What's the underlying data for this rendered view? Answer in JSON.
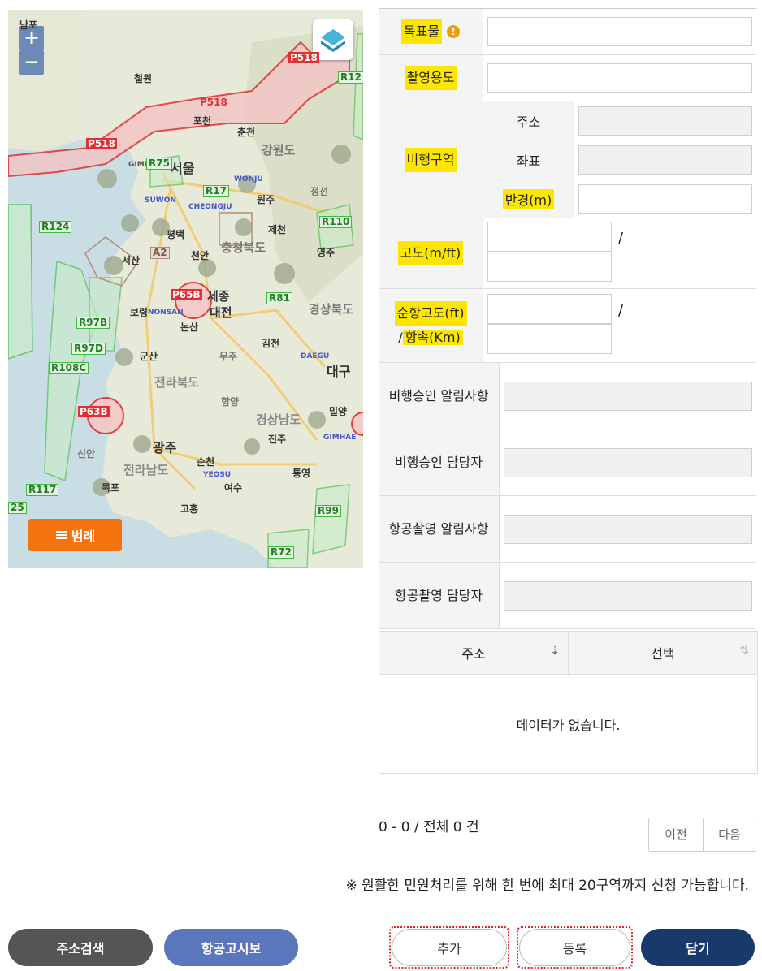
{
  "map": {
    "zoom_in": "+",
    "zoom_out": "—",
    "legend_label": "범례",
    "legend_icon": "menu-icon",
    "layer_icon": "layers-icon",
    "place_labels": [
      "남포",
      "철원",
      "포천",
      "춘천",
      "강원도",
      "서울",
      "원주",
      "평택",
      "제천",
      "영주",
      "충청북도",
      "서산",
      "천안",
      "세종",
      "보령",
      "대전",
      "논산",
      "김천",
      "경상북도",
      "대구",
      "군산",
      "무주",
      "전라북도",
      "함양",
      "밀양",
      "경상남도",
      "진주",
      "광주",
      "순천",
      "여수",
      "전라남도",
      "목포",
      "고흥",
      "통영",
      "신안",
      "정선",
      "GIMPO",
      "WONJU",
      "SUWON",
      "CHEONGJU",
      "NONSAN",
      "DAEGU",
      "GIMHAE",
      "YEOSU"
    ],
    "restricted_zones": [
      "P518",
      "P518",
      "P518",
      "P65B",
      "P63B"
    ],
    "control_zones": [
      "R12",
      "R75",
      "R17",
      "R110",
      "R124",
      "R81",
      "R97B",
      "R97D",
      "R108C",
      "R117",
      "R99",
      "R72",
      "25",
      "A2"
    ]
  },
  "form": {
    "target_label": "목표물",
    "target_value": "",
    "purpose_label": "촬영용도",
    "purpose_value": "",
    "area_label": "비행구역",
    "address_label": "주소",
    "coord_label": "좌표",
    "radius_label": "반경(m)",
    "altitude_label": "고도(m/ft)",
    "cruise_label": "순항고도(ft)",
    "slash": "/",
    "speed_prefix": "/",
    "speed_label": "항속(Km)",
    "flight_notice_label": "비행승인 알림사항",
    "flight_manager_label": "비행승인 담당자",
    "photo_notice_label": "항공촬영 알림사항",
    "photo_manager_label": "항공촬영 담당자"
  },
  "grid": {
    "columns": [
      "주소",
      "선택"
    ],
    "empty_text": "데이터가 없습니다."
  },
  "pagination": {
    "summary": "0 - 0 / 전체 0 건",
    "prev": "이전",
    "next": "다음"
  },
  "notice": "※ 원활한 민원처리를 위해 한 번에 최대 20구역까지 신청 가능합니다.",
  "buttons": {
    "address_search": "주소검색",
    "notam": "항공고시보",
    "add": "추가",
    "register": "등록",
    "close": "닫기"
  },
  "colors": {
    "legend_button": "#f4730f",
    "highlight": "#ffe600",
    "close_button": "#173a6b",
    "notam_button": "#5b77bb",
    "restricted_zone": "#e03030",
    "control_zone": "#3dbb3d"
  }
}
